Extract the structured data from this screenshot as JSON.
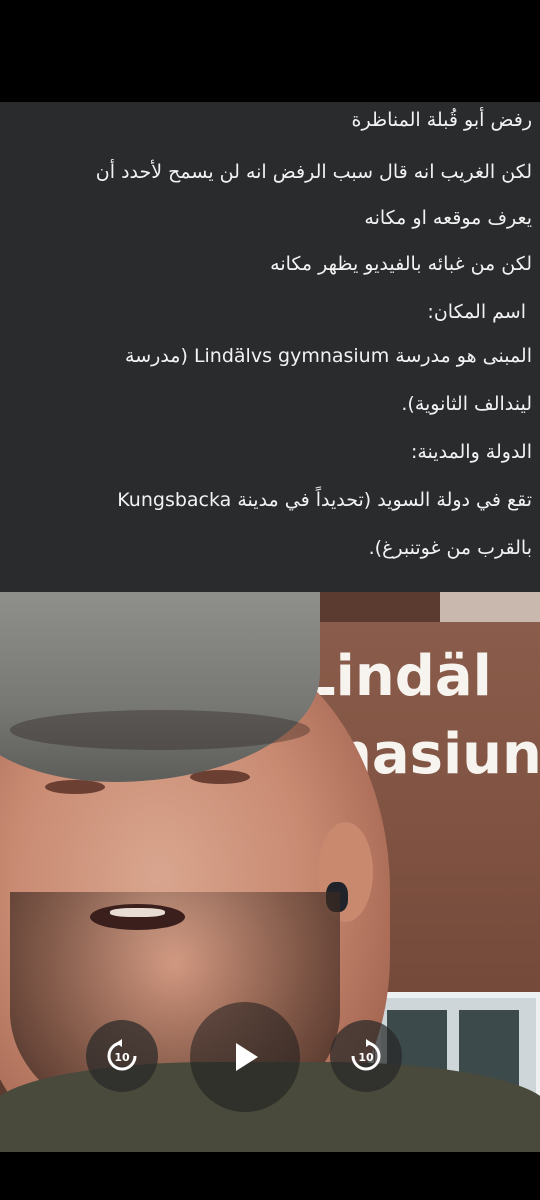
{
  "post": {
    "lines": [
      "رفض أبو قُبلة المناظرة",
      "لكن الغريب انه قال سبب الرفض انه لن يسمح لأحدد أن",
      "يعرف موقعه او مكانه",
      "لكن من غبائه بالفيديو يظهر مكانه",
      "اسم المكان:",
      "المبنى هو مدرسة Lindälvs gymnasium (مدرسة",
      "ليندالف الثانوية).",
      "الدولة والمدينة:",
      "تقع في دولة السويد (تحديداً في مدينة Kungsbacka",
      "بالقرب من غوتنبرغ)."
    ]
  },
  "video": {
    "sign_line1": "Lindäl",
    "sign_line2": "nasiun",
    "rewind_label": "10",
    "forward_label": "10"
  },
  "colors": {
    "panel_bg": "#2a2b2d",
    "text": "#f2f2f2",
    "control_bg": "rgba(40,40,40,0.72)"
  }
}
